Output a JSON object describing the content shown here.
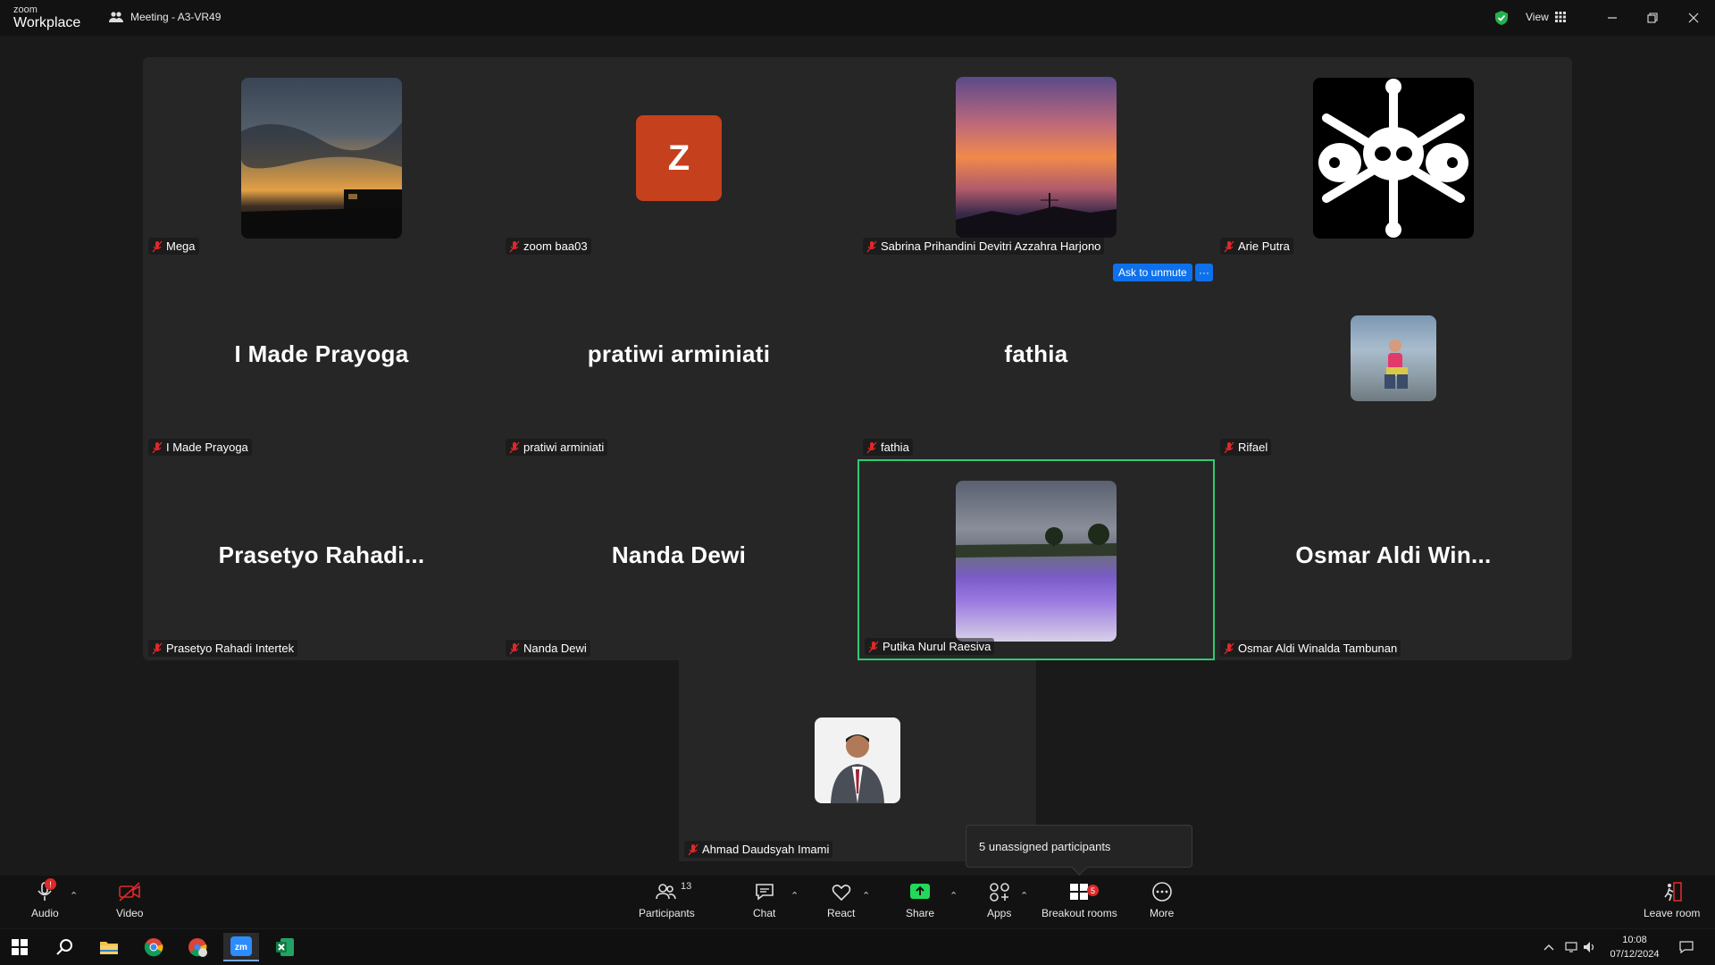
{
  "app": {
    "brand_small": "zoom",
    "brand_big": "Workplace",
    "meeting_title": "Meeting - A3-VR49",
    "view_label": "View"
  },
  "participants": [
    {
      "name": "Mega",
      "display": ""
    },
    {
      "name": "zoom baa03",
      "display": "Z"
    },
    {
      "name": "Sabrina Prihandini Devitri Azzahra Harjono",
      "display": ""
    },
    {
      "name": "Arie Putra",
      "display": ""
    },
    {
      "name": "I Made Prayoga",
      "display": "I Made Prayoga"
    },
    {
      "name": "pratiwi arminiati",
      "display": "pratiwi arminiati"
    },
    {
      "name": "fathia",
      "display": "fathia"
    },
    {
      "name": "Rifael",
      "display": ""
    },
    {
      "name": "Prasetyo Rahadi Intertek",
      "display": "Prasetyo  Rahadi..."
    },
    {
      "name": "Nanda Dewi",
      "display": "Nanda Dewi"
    },
    {
      "name": "Putika Nurul Raesiva",
      "display": ""
    },
    {
      "name": "Osmar Aldi Winalda Tambunan",
      "display": "Osmar  Aldi  Win..."
    },
    {
      "name": "Ahmad Daudsyah Imami",
      "display": ""
    }
  ],
  "ask_unmute": {
    "label": "Ask to unmute",
    "more": "···"
  },
  "tooltip": "5 unassigned participants",
  "toolbar": {
    "audio": "Audio",
    "audio_badge": "!",
    "video": "Video",
    "participants": "Participants",
    "participants_count": "13",
    "chat": "Chat",
    "react": "React",
    "share": "Share",
    "apps": "Apps",
    "breakout": "Breakout rooms",
    "breakout_badge": "5",
    "more": "More",
    "leave": "Leave room"
  },
  "taskbar": {
    "time": "10:08",
    "date": "07/12/2024"
  },
  "colors": {
    "accent": "#0e71eb",
    "active_speaker": "#2ecc71",
    "share_green": "#23d959",
    "danger": "#e02828"
  }
}
